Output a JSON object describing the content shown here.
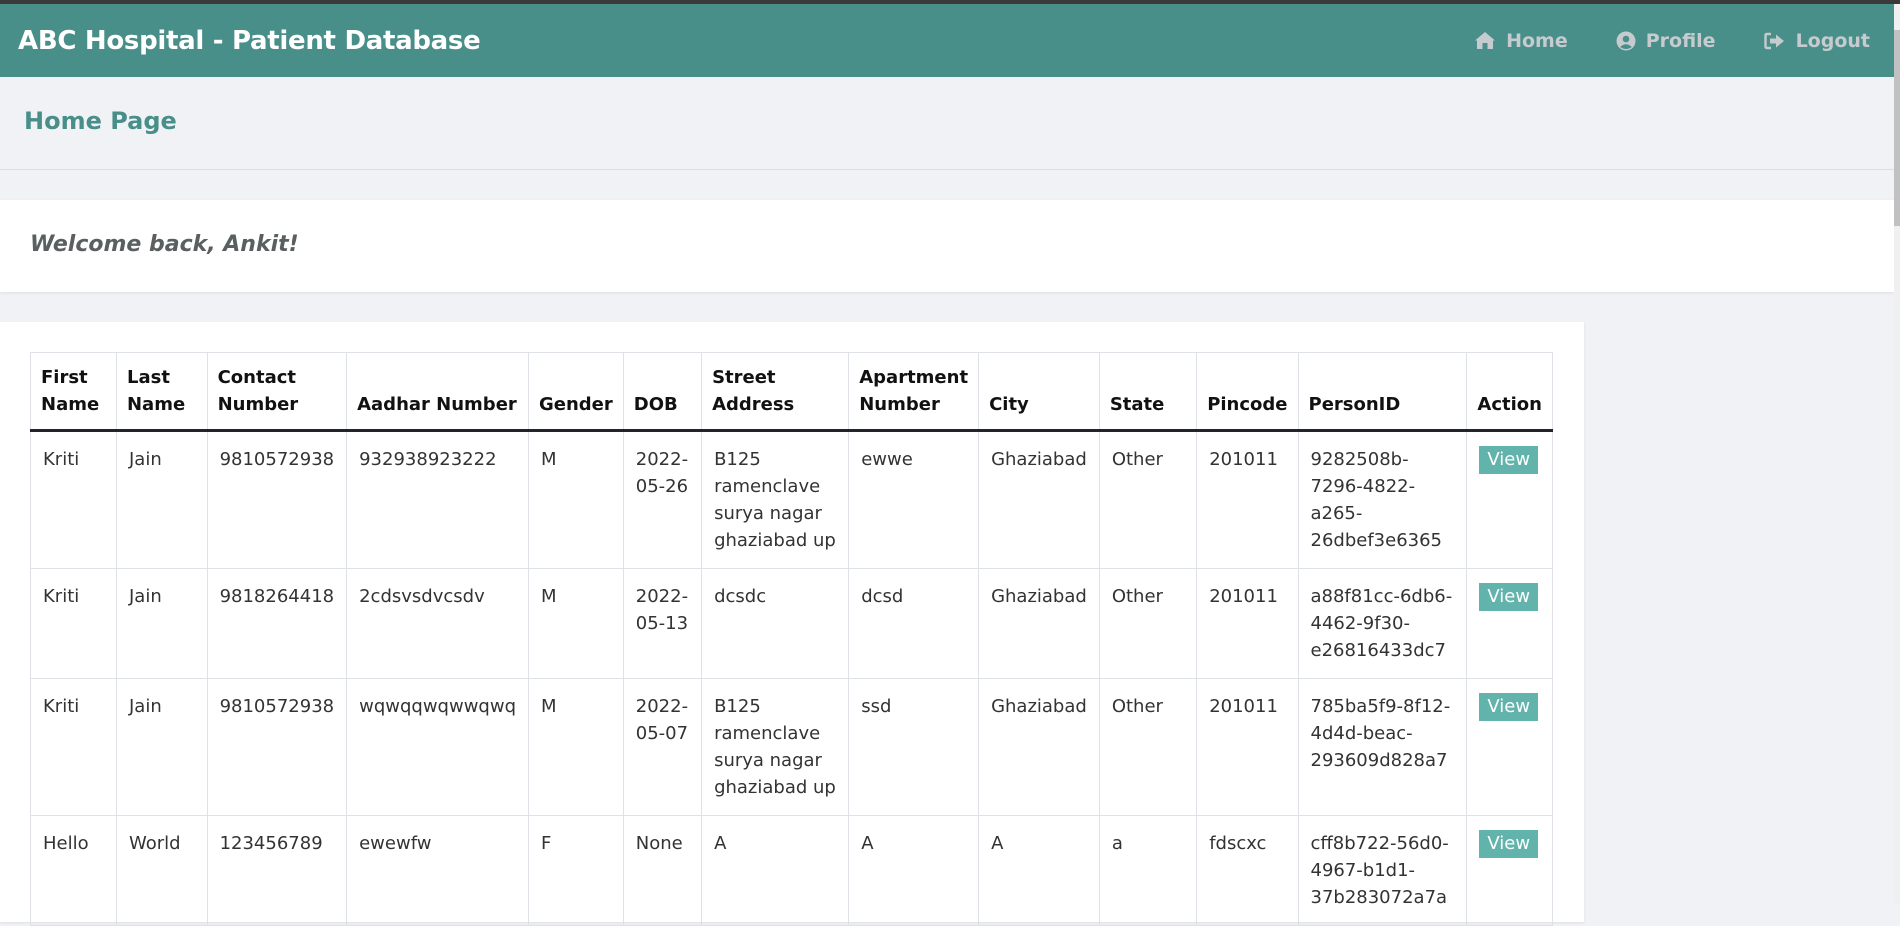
{
  "app": {
    "title": "ABC Hospital - Patient Database"
  },
  "nav": {
    "items": [
      {
        "label": "Home",
        "icon": "home-icon"
      },
      {
        "label": "Profile",
        "icon": "user-circle-icon"
      },
      {
        "label": "Logout",
        "icon": "sign-out-icon"
      }
    ]
  },
  "page": {
    "title": "Home Page",
    "welcome": "Welcome back, Ankit!"
  },
  "colors": {
    "navbar": "#488e89",
    "accent": "#488e89",
    "view_button": "#63b3ad"
  },
  "table": {
    "headers": [
      "First Name",
      "Last Name",
      "Contact Number",
      "Aadhar Number",
      "Gender",
      "DOB",
      "Street Address",
      "Apartment Number",
      "City",
      "State",
      "Pincode",
      "PersonID",
      "Action"
    ],
    "rows": [
      {
        "first_name": "Kriti",
        "last_name": "Jain",
        "contact": "9810572938",
        "aadhar": "932938923222",
        "gender": "M",
        "dob": "2022-05-26",
        "street": "B125 ramenclave surya nagar ghaziabad up",
        "apartment": "ewwe",
        "city": "Ghaziabad",
        "state": "Other",
        "pincode": "201011",
        "person_id": "9282508b-7296-4822-a265-26dbef3e6365",
        "action": "View"
      },
      {
        "first_name": "Kriti",
        "last_name": "Jain",
        "contact": "9818264418",
        "aadhar": "2cdsvsdvcsdv",
        "gender": "M",
        "dob": "2022-05-13",
        "street": "dcsdc",
        "apartment": "dcsd",
        "city": "Ghaziabad",
        "state": "Other",
        "pincode": "201011",
        "person_id": "a88f81cc-6db6-4462-9f30-e26816433dc7",
        "action": "View"
      },
      {
        "first_name": "Kriti",
        "last_name": "Jain",
        "contact": "9810572938",
        "aadhar": "wqwqqwqwwqwq",
        "gender": "M",
        "dob": "2022-05-07",
        "street": "B125 ramenclave surya nagar ghaziabad up",
        "apartment": "ssd",
        "city": "Ghaziabad",
        "state": "Other",
        "pincode": "201011",
        "person_id": "785ba5f9-8f12-4d4d-beac-293609d828a7",
        "action": "View"
      },
      {
        "first_name": "Hello",
        "last_name": "World",
        "contact": "123456789",
        "aadhar": "ewewfw",
        "gender": "F",
        "dob": "None",
        "street": "A",
        "apartment": "A",
        "city": "A",
        "state": "a",
        "pincode": "fdscxc",
        "person_id": "cff8b722-56d0-4967-b1d1-37b283072a7a",
        "action": "View"
      }
    ]
  }
}
